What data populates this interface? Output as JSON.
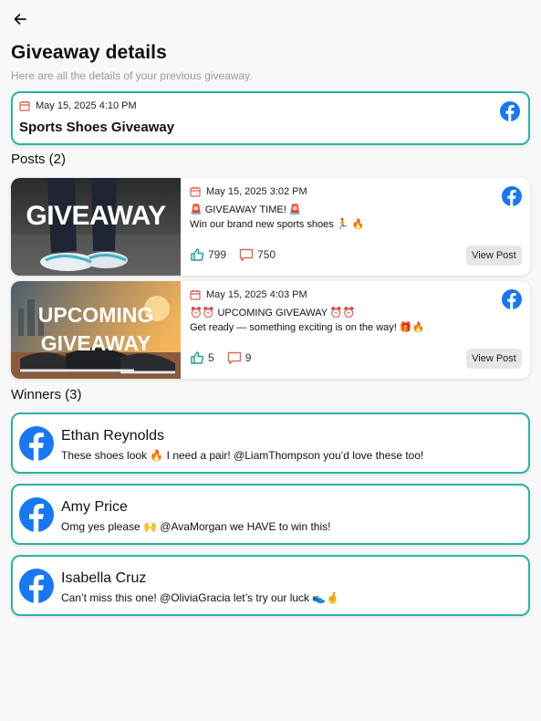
{
  "header": {
    "title": "Giveaway details",
    "subtitle": "Here are all the details of your previous giveaway."
  },
  "giveaway": {
    "date": "May 15, 2025 4:10 PM",
    "name": "Sports Shoes Giveaway",
    "platform_icon": "facebook-icon"
  },
  "posts_section": {
    "label": "Posts (2)"
  },
  "posts": [
    {
      "date": "May 15, 2025 3:02 PM",
      "line1": "🚨 GIVEAWAY TIME! 🚨",
      "line2": "Win our brand new sports shoes 🏃 🔥",
      "likes": "799",
      "comments": "750",
      "button": "View Post",
      "thumb_text": "GIVEAWAY"
    },
    {
      "date": "May 15, 2025 4:03 PM",
      "line1": "⏰⏰ UPCOMING GIVEAWAY ⏰⏰",
      "line2": "Get ready — something exciting is on the way! 🎁🔥",
      "likes": "5",
      "comments": "9",
      "button": "View Post",
      "thumb_text_1": "UPCOMING",
      "thumb_text_2": "GIVEAWAY"
    }
  ],
  "winners_section": {
    "label": "Winners (3)"
  },
  "winners": [
    {
      "name": "Ethan Reynolds",
      "comment": "These shoes look 🔥 I need a pair! @LiamThompson you’d love these too!"
    },
    {
      "name": "Amy Price",
      "comment": "Omg yes please 🙌 @AvaMorgan we HAVE to win this!"
    },
    {
      "name": "Isabella Cruz",
      "comment": "Can’t miss this one! @OliviaGracia let’s try our luck 👟🤞"
    }
  ],
  "colors": {
    "accent": "#2bb3a3",
    "facebook": "#1877f2",
    "calendar": "#e05a4f",
    "like": "#1aa08f",
    "comment": "#e06a4f"
  }
}
